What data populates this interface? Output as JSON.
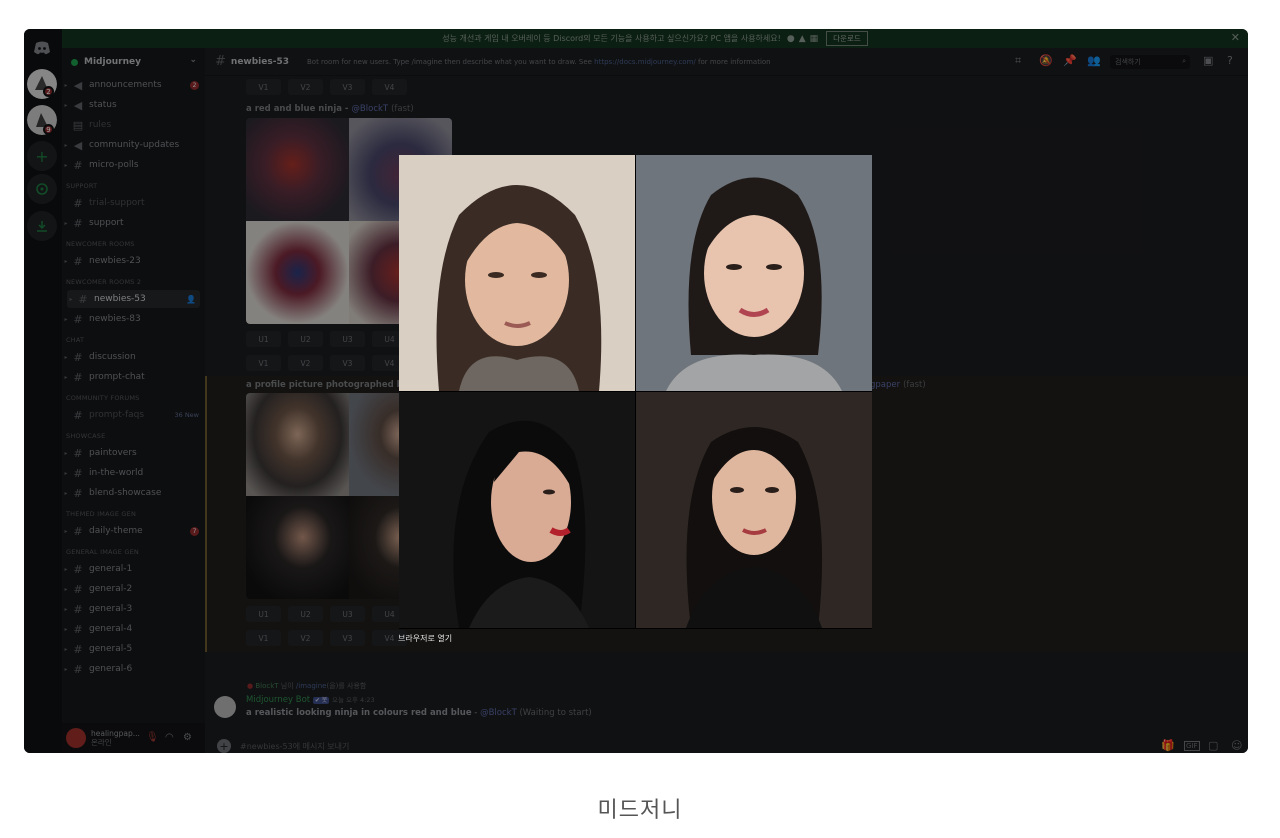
{
  "banner": {
    "text": "성능 개선과 게임 내 오버레이 등 Discord의 모든 기능을 사용하고 싶으신가요? PC 앱을 사용하세요!",
    "download_label": "다운로드",
    "close_icon": "close-icon"
  },
  "rail": {
    "badges": [
      "2",
      "9"
    ]
  },
  "server": {
    "name": "Midjourney"
  },
  "channels": [
    {
      "label": "announcements",
      "badge": "2",
      "icon": "megaphone-icon"
    },
    {
      "label": "status",
      "icon": "megaphone-icon"
    },
    {
      "label": "rules",
      "icon": "rules-icon",
      "dim": true
    },
    {
      "label": "community-updates",
      "icon": "megaphone-icon"
    },
    {
      "label": "micro-polls",
      "icon": "hash-icon"
    }
  ],
  "categories": {
    "support": "SUPPORT",
    "newcomer_rooms": "NEWCOMER ROOMS",
    "newcomer_rooms_2": "NEWCOMER ROOMS 2",
    "chat": "CHAT",
    "community_forums": "COMMUNITY FORUMS",
    "showcase": "SHOWCASE",
    "themed_image_gen": "THEMED IMAGE GEN",
    "general_image_gen": "GENERAL IMAGE GEN"
  },
  "support_channels": [
    "trial-support",
    "support"
  ],
  "newcomer_channels": [
    "newbies-23"
  ],
  "newcomer2_channels": [
    "newbies-53",
    "newbies-83"
  ],
  "chat_channels": [
    "discussion",
    "prompt-chat"
  ],
  "forum_channels": [
    {
      "label": "prompt-faqs",
      "new": "36 New"
    }
  ],
  "showcase_channels": [
    "paintovers",
    "in-the-world",
    "blend-showcase"
  ],
  "themed_channels": [
    {
      "label": "daily-theme",
      "badge": "7"
    }
  ],
  "general_channels": [
    "general-1",
    "general-2",
    "general-3",
    "general-4",
    "general-5",
    "general-6"
  ],
  "user": {
    "name": "healingpap...",
    "status": "온라인"
  },
  "header": {
    "channel": "newbies-53",
    "topic": "Bot room for new users. Type /imagine then describe what you want to draw. See",
    "topic_link": "https://docs.midjourney.com/",
    "topic_tail": "for more information",
    "search_placeholder": "검색하기"
  },
  "messages": {
    "v_buttons": [
      "V1",
      "V2",
      "V3",
      "V4"
    ],
    "u_buttons": [
      "U1",
      "U2",
      "U3",
      "U4"
    ],
    "ninja_prompt": "a red and blue ninja",
    "ninja_mention": "@BlockT",
    "ninja_speed": "(fast)",
    "profile_prompt": "a profile picture photographed by a g",
    "profile_mention_tail": "gpaper",
    "profile_speed": "(fast)"
  },
  "bottom": {
    "reply_user": "BlockT",
    "reply_text": "님이",
    "reply_cmd": "/imagine",
    "reply_tail": "(을)를 사용함",
    "bot_name": "Midjourney Bot",
    "bot_tag": "✔ 봇",
    "time": "오늘 오후 4:23",
    "prompt": "a realistic looking ninja in colours red and blue",
    "mention": "@BlockT",
    "status": "(Waiting to start)"
  },
  "input": {
    "placeholder": "#newbies-53에 메시지 보내기"
  },
  "viewer": {
    "open_in_browser": "브라우저로 열기"
  },
  "caption": "미드저니"
}
